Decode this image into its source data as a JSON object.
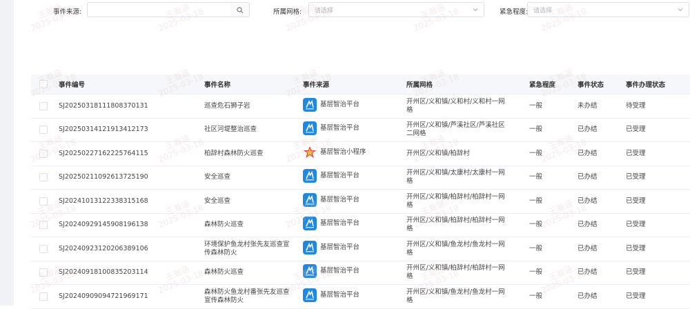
{
  "filters": {
    "source_label": "事件来源:",
    "source_value": "",
    "grid_label": "所属网格:",
    "grid_placeholder": "请选择",
    "urgency_label": "紧急程度:",
    "urgency_placeholder": "请选择"
  },
  "watermark": {
    "name": "王瀚涵",
    "date": "2025-03-18"
  },
  "table": {
    "headers": [
      "事件编号",
      "事件名称",
      "事件来源",
      "所属网格",
      "紧急程度",
      "事件状态",
      "事件办理状态"
    ],
    "rows": [
      {
        "id": "SJ20250318111808370131",
        "name": "巡查危石狮子岩",
        "source": "基层智治平台",
        "source_icon": "platform-icon",
        "grid": "开州区/义和镇/义和村/义和村一网格",
        "urgency": "一般",
        "status": "未办结",
        "handling": "待受理"
      },
      {
        "id": "SJ20250314121913412173",
        "name": "社区河堤整治巡查",
        "source": "基层智治平台",
        "source_icon": "platform-icon",
        "grid": "开州区/义和镇/芦溪社区/芦溪社区二网格",
        "urgency": "一般",
        "status": "已办结",
        "handling": "已受理"
      },
      {
        "id": "SJ20250227162225764115",
        "name": "柏辞村森林防火巡查",
        "source": "基层智治小程序",
        "source_icon": "miniprogram-icon",
        "grid": "开州区/义和镇/柏辞村",
        "urgency": "一般",
        "status": "已办结",
        "handling": "已受理"
      },
      {
        "id": "SJ20250211092613725190",
        "name": "安全巡查",
        "source": "基层智治平台",
        "source_icon": "platform-icon",
        "grid": "开州区/义和镇/太康村/太康村一网格",
        "urgency": "一般",
        "status": "已办结",
        "handling": "已受理"
      },
      {
        "id": "SJ20241013122338315168",
        "name": "安全巡查",
        "source": "基层智治平台",
        "source_icon": "platform-icon",
        "grid": "开州区/义和镇/柏辞村/柏辞村一网格",
        "urgency": "一般",
        "status": "已办结",
        "handling": "已受理"
      },
      {
        "id": "SJ20240929145908196138",
        "name": "森林防火巡查",
        "source": "基层智治平台",
        "source_icon": "platform-icon",
        "grid": "开州区/义和镇/柏辞村/柏辞村一网格",
        "urgency": "一般",
        "status": "已办结",
        "handling": "已受理"
      },
      {
        "id": "SJ20240923120206389106",
        "name": "环境保护鱼龙村张先友巡查宣传森林防火",
        "source": "基层智治平台",
        "source_icon": "platform-icon",
        "grid": "开州区/义和镇/鱼龙村/鱼龙村一网格",
        "urgency": "一般",
        "status": "已办结",
        "handling": "已受理"
      },
      {
        "id": "SJ20240918100835203114",
        "name": "森林防火巡查",
        "source": "基层智治平台",
        "source_icon": "platform-icon",
        "grid": "开州区/义和镇/柏辞村/柏辞村一网格",
        "urgency": "一般",
        "status": "已办结",
        "handling": "已受理"
      },
      {
        "id": "SJ20240909094721969171",
        "name": "森林防火鱼龙村番张先友巡查宣传森林防火",
        "source": "基层智治平台",
        "source_icon": "platform-icon",
        "grid": "开州区/义和镇/鱼龙村/鱼龙村一网格",
        "urgency": "一般",
        "status": "已办结",
        "handling": "已受理"
      }
    ]
  }
}
